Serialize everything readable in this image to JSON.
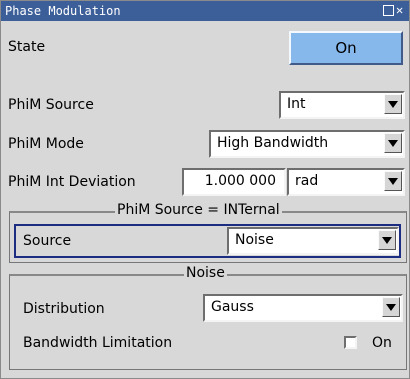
{
  "window": {
    "title": "Phase Modulation"
  },
  "state": {
    "label": "State",
    "button": "On"
  },
  "phim_source": {
    "label": "PhiM Source",
    "value": "Int"
  },
  "phim_mode": {
    "label": "PhiM Mode",
    "value": "High Bandwidth"
  },
  "phim_deviation": {
    "label": "PhiM Int Deviation",
    "value": "1.000 000",
    "unit": "rad"
  },
  "internal_group": {
    "title": "PhiM Source = INTernal",
    "source_label": "Source",
    "source_value": "Noise"
  },
  "noise_group": {
    "title": "Noise",
    "distribution_label": "Distribution",
    "distribution_value": "Gauss",
    "bandwidth_label": "Bandwidth Limitation",
    "bandwidth_checkbox_label": "On",
    "bandwidth_checked": false
  }
}
